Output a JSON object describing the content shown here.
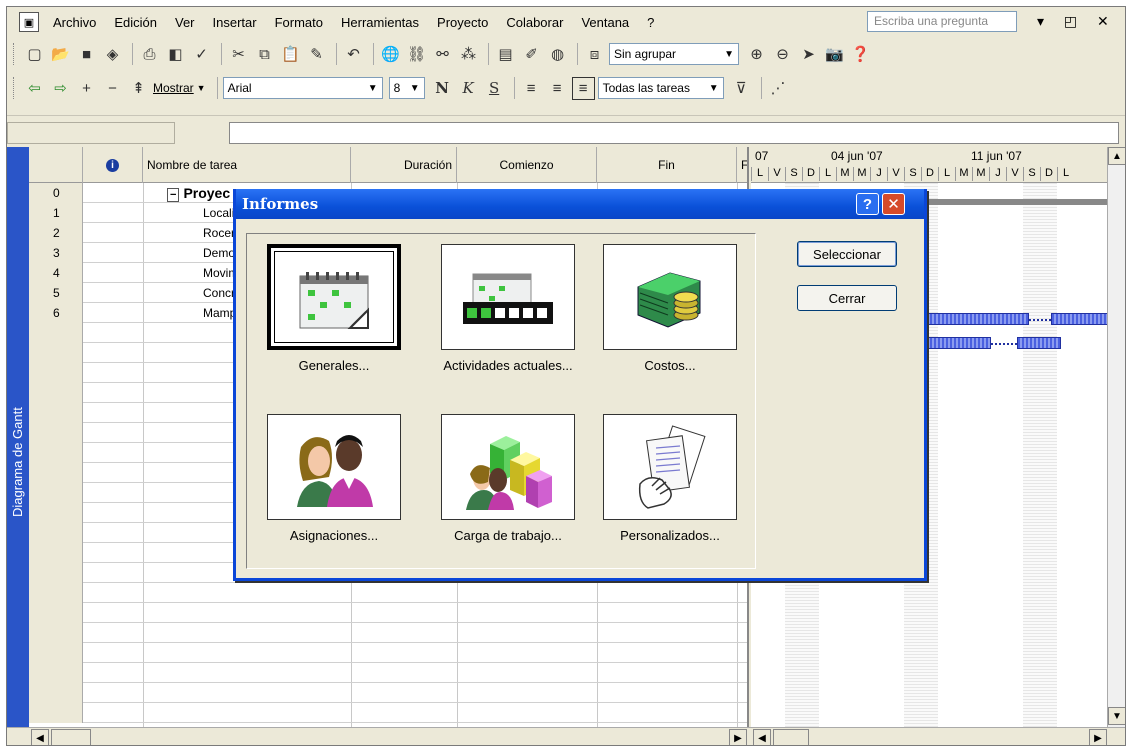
{
  "menu": {
    "items": [
      "Archivo",
      "Edición",
      "Ver",
      "Insertar",
      "Formato",
      "Herramientas",
      "Proyecto",
      "Colaborar",
      "Ventana",
      "?"
    ],
    "ask_placeholder": "Escriba una pregunta"
  },
  "toolbar": {
    "group_combo": "Sin agrupar",
    "show_label": "Mostrar",
    "font_combo": "Arial",
    "size_combo": "8",
    "filter_combo": "Todas las tareas",
    "bold_label": "N",
    "italic_label": "K",
    "underline_label": "S"
  },
  "grid": {
    "headers": {
      "info": "i",
      "name": "Nombre de tarea",
      "duration": "Duración",
      "start": "Comienzo",
      "end": "Fin",
      "pred": "F"
    },
    "rows": [
      {
        "id": "0",
        "name": "Proyec"
      },
      {
        "id": "1",
        "name": "Localiz"
      },
      {
        "id": "2",
        "name": "Rocer"
      },
      {
        "id": "3",
        "name": "Demol"
      },
      {
        "id": "4",
        "name": "Movim"
      },
      {
        "id": "5",
        "name": "Concr"
      },
      {
        "id": "6",
        "name": "Mamp"
      }
    ]
  },
  "gantt": {
    "weeks": [
      "07",
      "04 jun '07",
      "11 jun '07"
    ],
    "days": [
      "L",
      "V",
      "S",
      "D",
      "L",
      "M",
      "M",
      "J",
      "V",
      "S",
      "D",
      "L",
      "M",
      "M",
      "J",
      "V",
      "S",
      "D",
      "L"
    ]
  },
  "view_bar": {
    "label": "Diagrama de Gantt"
  },
  "dialog": {
    "title": "Informes",
    "help": "?",
    "close": "✕",
    "select_button": "Seleccionar",
    "close_button": "Cerrar",
    "tiles": [
      {
        "label": "Generales..."
      },
      {
        "label": "Actividades actuales..."
      },
      {
        "label": "Costos..."
      },
      {
        "label": "Asignaciones..."
      },
      {
        "label": "Carga de trabajo..."
      },
      {
        "label": "Personalizados..."
      }
    ]
  }
}
